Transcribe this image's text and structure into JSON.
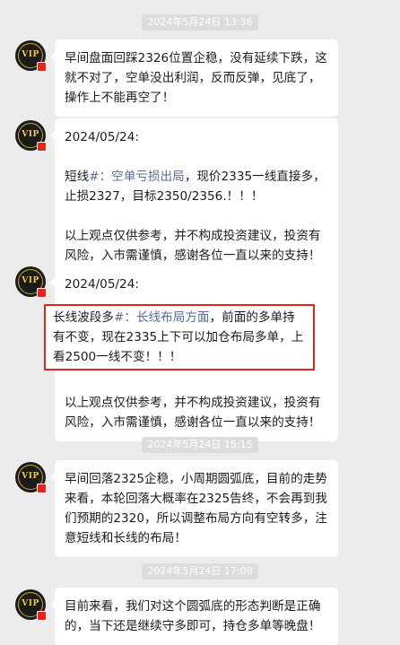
{
  "timestamps": [
    "2024年5月24日 13:36",
    "2024年5月24日 15:15",
    "2024年5月24日 17:08"
  ],
  "avatar_text": "VIP",
  "messages": [
    {
      "text": "早间盘面回踩2326位置企稳，没有延续下跌，这就不对了，空单没出利润，反而反弹，见底了，操作上不能再空了！"
    },
    {
      "date": "2024/05/24:",
      "prefix": "短线",
      "tag": "#：空单亏损出局",
      "body": "，现价2335一线直接多，止损2327，目标2350/2356.！！！",
      "disclaimer": "以上观点仅供参考，并不构成投资建议，投资有风险，入市需谨慎，感谢各位一直以来的支持！"
    },
    {
      "date": "2024/05/24:",
      "prefix": "长线波段多",
      "tag": "#：长线布局方面",
      "body": "，前面的多单持有不变，现在2335上下可以加仓布局多单，上看2500一线不变！！！",
      "disclaimer": "以上观点仅供参考，并不构成投资建议，投资有风险，入市需谨慎，感谢各位一直以来的支持！"
    },
    {
      "text": "早间回落2325企稳，小周期圆弧底，目前的走势来看，本轮回落大概率在2325告终，不会再到我们预期的2320，所以调整布局方向有空转多，注意短线和长线的布局！"
    },
    {
      "text": "目前来看，我们对这个圆弧底的形态判断是正确的，当下还是继续守多即可，持仓多单等晚盘！"
    }
  ]
}
